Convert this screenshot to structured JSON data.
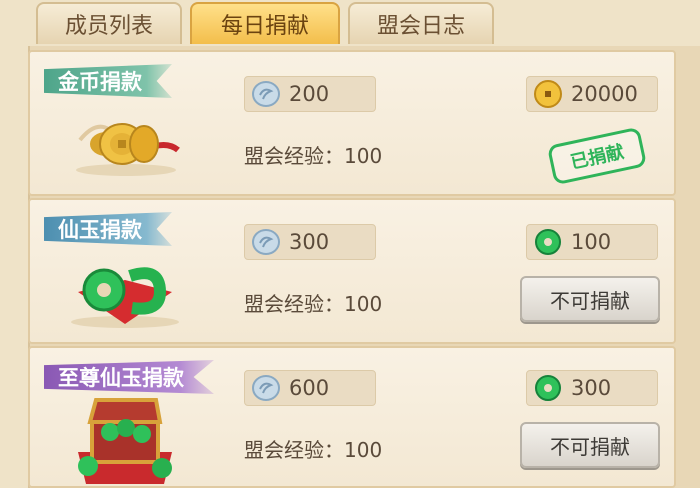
{
  "tabs": [
    {
      "label": "成员列表",
      "active": false
    },
    {
      "label": "每日捐献",
      "active": true
    },
    {
      "label": "盟会日志",
      "active": false
    }
  ],
  "donations": [
    {
      "title": "金币捐款",
      "ribbon_color": "#4ea58a",
      "cost": "200",
      "cost_icon": "silver-coin-icon",
      "reward": "20000",
      "reward_icon": "gold-coin-icon",
      "exp_label": "盟会经验：",
      "exp_value": "100",
      "status": "已捐献"
    },
    {
      "title": "仙玉捐款",
      "ribbon_color": "#4d8fb0",
      "cost": "300",
      "cost_icon": "silver-coin-icon",
      "reward": "100",
      "reward_icon": "jade-icon",
      "exp_label": "盟会经验：",
      "exp_value": "100",
      "button": "不可捐献"
    },
    {
      "title": "至尊仙玉捐款",
      "ribbon_color": "#8a58b4",
      "cost": "600",
      "cost_icon": "silver-coin-icon",
      "reward": "300",
      "reward_icon": "jade-icon",
      "exp_label": "盟会经验：",
      "exp_value": "100",
      "button": "不可捐献"
    }
  ]
}
